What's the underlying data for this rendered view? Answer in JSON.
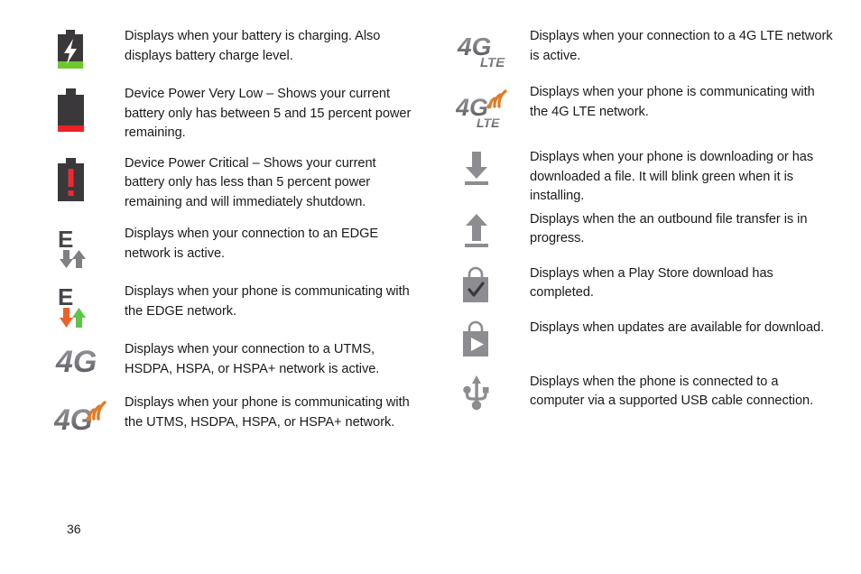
{
  "page": {
    "number": "36",
    "type": "status-icon-reference-table"
  },
  "left_column": {
    "rows": [
      {
        "icon": "battery-charging-icon",
        "icon_colors": {
          "body": "#3b383c",
          "fill": "#6fc72e",
          "bolt": "#ffffff"
        },
        "text": "Displays when your battery is charging. Also displays battery charge level."
      },
      {
        "icon": "battery-very-low-icon",
        "icon_colors": {
          "body": "#3b383c",
          "fill": "#ed2024"
        },
        "text": "Device Power Very Low – Shows your current battery only has between 5 and 15 percent power remaining."
      },
      {
        "icon": "battery-critical-icon",
        "icon_colors": {
          "body": "#3b383c",
          "mark": "#ed2a2f"
        },
        "text": "Device Power Critical – Shows your current battery only has less than 5 percent power remaining and will immediately shutdown."
      },
      {
        "icon": "edge-network-icon",
        "icon_label": "E",
        "icon_colors": {
          "letter": "#46464a",
          "arrows": "#808084"
        },
        "text": "Displays when your connection to an EDGE network is active."
      },
      {
        "icon": "edge-network-active-icon",
        "icon_label": "E",
        "icon_colors": {
          "letter": "#46464a",
          "down_arrow": "#f0602a",
          "up_arrow": "#5dc64a"
        },
        "text": "Displays when your phone is communicating with the EDGE network."
      },
      {
        "icon": "four-g-icon",
        "icon_label": "4G",
        "icon_colors": {
          "text": "#6b6b70"
        },
        "text": "Displays when your connection to a UTMS, HSDPA, HSPA, or HSPA+ network is active."
      },
      {
        "icon": "four-g-active-icon",
        "icon_label": "4G",
        "icon_colors": {
          "text": "#6b6b70",
          "signal": "#e07b26"
        },
        "text": "Displays when your phone is communicating with the UTMS, HSDPA, HSPA, or HSPA+ network."
      }
    ]
  },
  "right_column": {
    "rows": [
      {
        "icon": "four-g-lte-icon",
        "icon_label": "4G",
        "icon_sublabel": "LTE",
        "icon_colors": {
          "text": "#6b6b70"
        },
        "text": "Displays when your connection to a 4G LTE network is active."
      },
      {
        "icon": "four-g-lte-active-icon",
        "icon_label": "4G",
        "icon_sublabel": "LTE",
        "icon_colors": {
          "text": "#6b6b70",
          "signal": "#e07b26"
        },
        "text": "Displays when your phone is communicating with the 4G LTE network."
      },
      {
        "icon": "download-arrow-icon",
        "icon_colors": {
          "arrow": "#8d8d91"
        },
        "text": "Displays when your phone is downloading or has downloaded a file. It will blink green when it is installing."
      },
      {
        "icon": "upload-arrow-icon",
        "icon_colors": {
          "arrow": "#8d8d91"
        },
        "text": "Displays when the an outbound file transfer is in progress."
      },
      {
        "icon": "play-store-download-complete-icon",
        "icon_colors": {
          "bag": "#8d8d91",
          "check": "#3b383c"
        },
        "text": "Displays when a Play Store download has completed."
      },
      {
        "icon": "play-store-updates-available-icon",
        "icon_colors": {
          "bag": "#8d8d91",
          "play": "#ffffff"
        },
        "text": "Displays when updates are available for download."
      },
      {
        "icon": "usb-connection-icon",
        "icon_colors": {
          "usb": "#8d8d91"
        },
        "text": "Displays when the phone is connected to a computer via a supported USB cable connection."
      }
    ]
  }
}
